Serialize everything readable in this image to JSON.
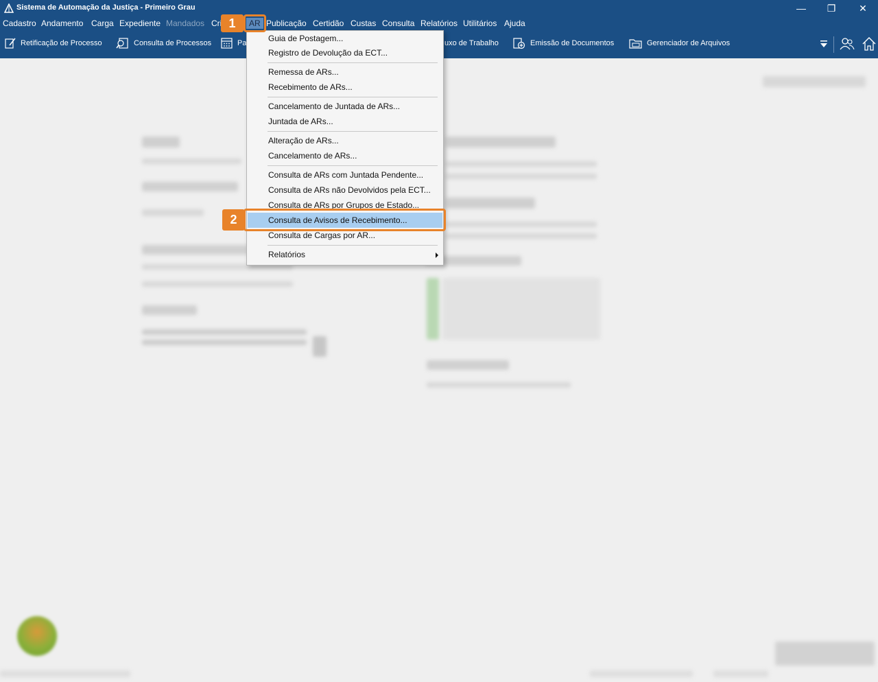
{
  "window": {
    "title": "Sistema de Automação da Justiça - Primeiro Grau",
    "controls": {
      "minimize": "—",
      "restore": "❐",
      "close": "✕"
    }
  },
  "menubar": {
    "items": [
      "Cadastro",
      "Andamento",
      "Carga",
      "Expediente",
      "Mandados",
      "Cri",
      "AR",
      "Publicação",
      "Certidão",
      "Custas",
      "Consulta",
      "Relatórios",
      "Utilitários",
      "Ajuda"
    ],
    "disabled": "Mandados",
    "active": "AR"
  },
  "toolbar": {
    "retificacao": "Retificação de Processo",
    "consulta_processos": "Consulta de Processos",
    "pa": "Pa",
    "fluxo_trabalho": "uxo de Trabalho",
    "emissao_documentos": "Emissão de Documentos",
    "gerenciador_arquivos": "Gerenciador de Arquivos"
  },
  "dropdown": {
    "items": [
      "Guia de Postagem...",
      "Registro de Devolução da ECT...",
      "Remessa de ARs...",
      "Recebimento de ARs...",
      "Cancelamento de Juntada de ARs...",
      "Juntada de ARs...",
      "Alteração de ARs...",
      "Cancelamento de ARs...",
      "Consulta de ARs com Juntada Pendente...",
      "Consulta de ARs não Devolvidos pela ECT...",
      "Consulta de ARs por Grupos de Estado...",
      "Consulta de Avisos de Recebimento...",
      "Consulta de Cargas por AR...",
      "Relatórios"
    ],
    "highlighted": "Consulta de Avisos de Recebimento...",
    "submenu_item": "Relatórios"
  },
  "callouts": {
    "step1": "1",
    "step2": "2",
    "color": "#e8832a"
  },
  "colors": {
    "titlebar": "#1b4f85",
    "highlight": "#a8cef0",
    "workspace": "#efefef"
  }
}
